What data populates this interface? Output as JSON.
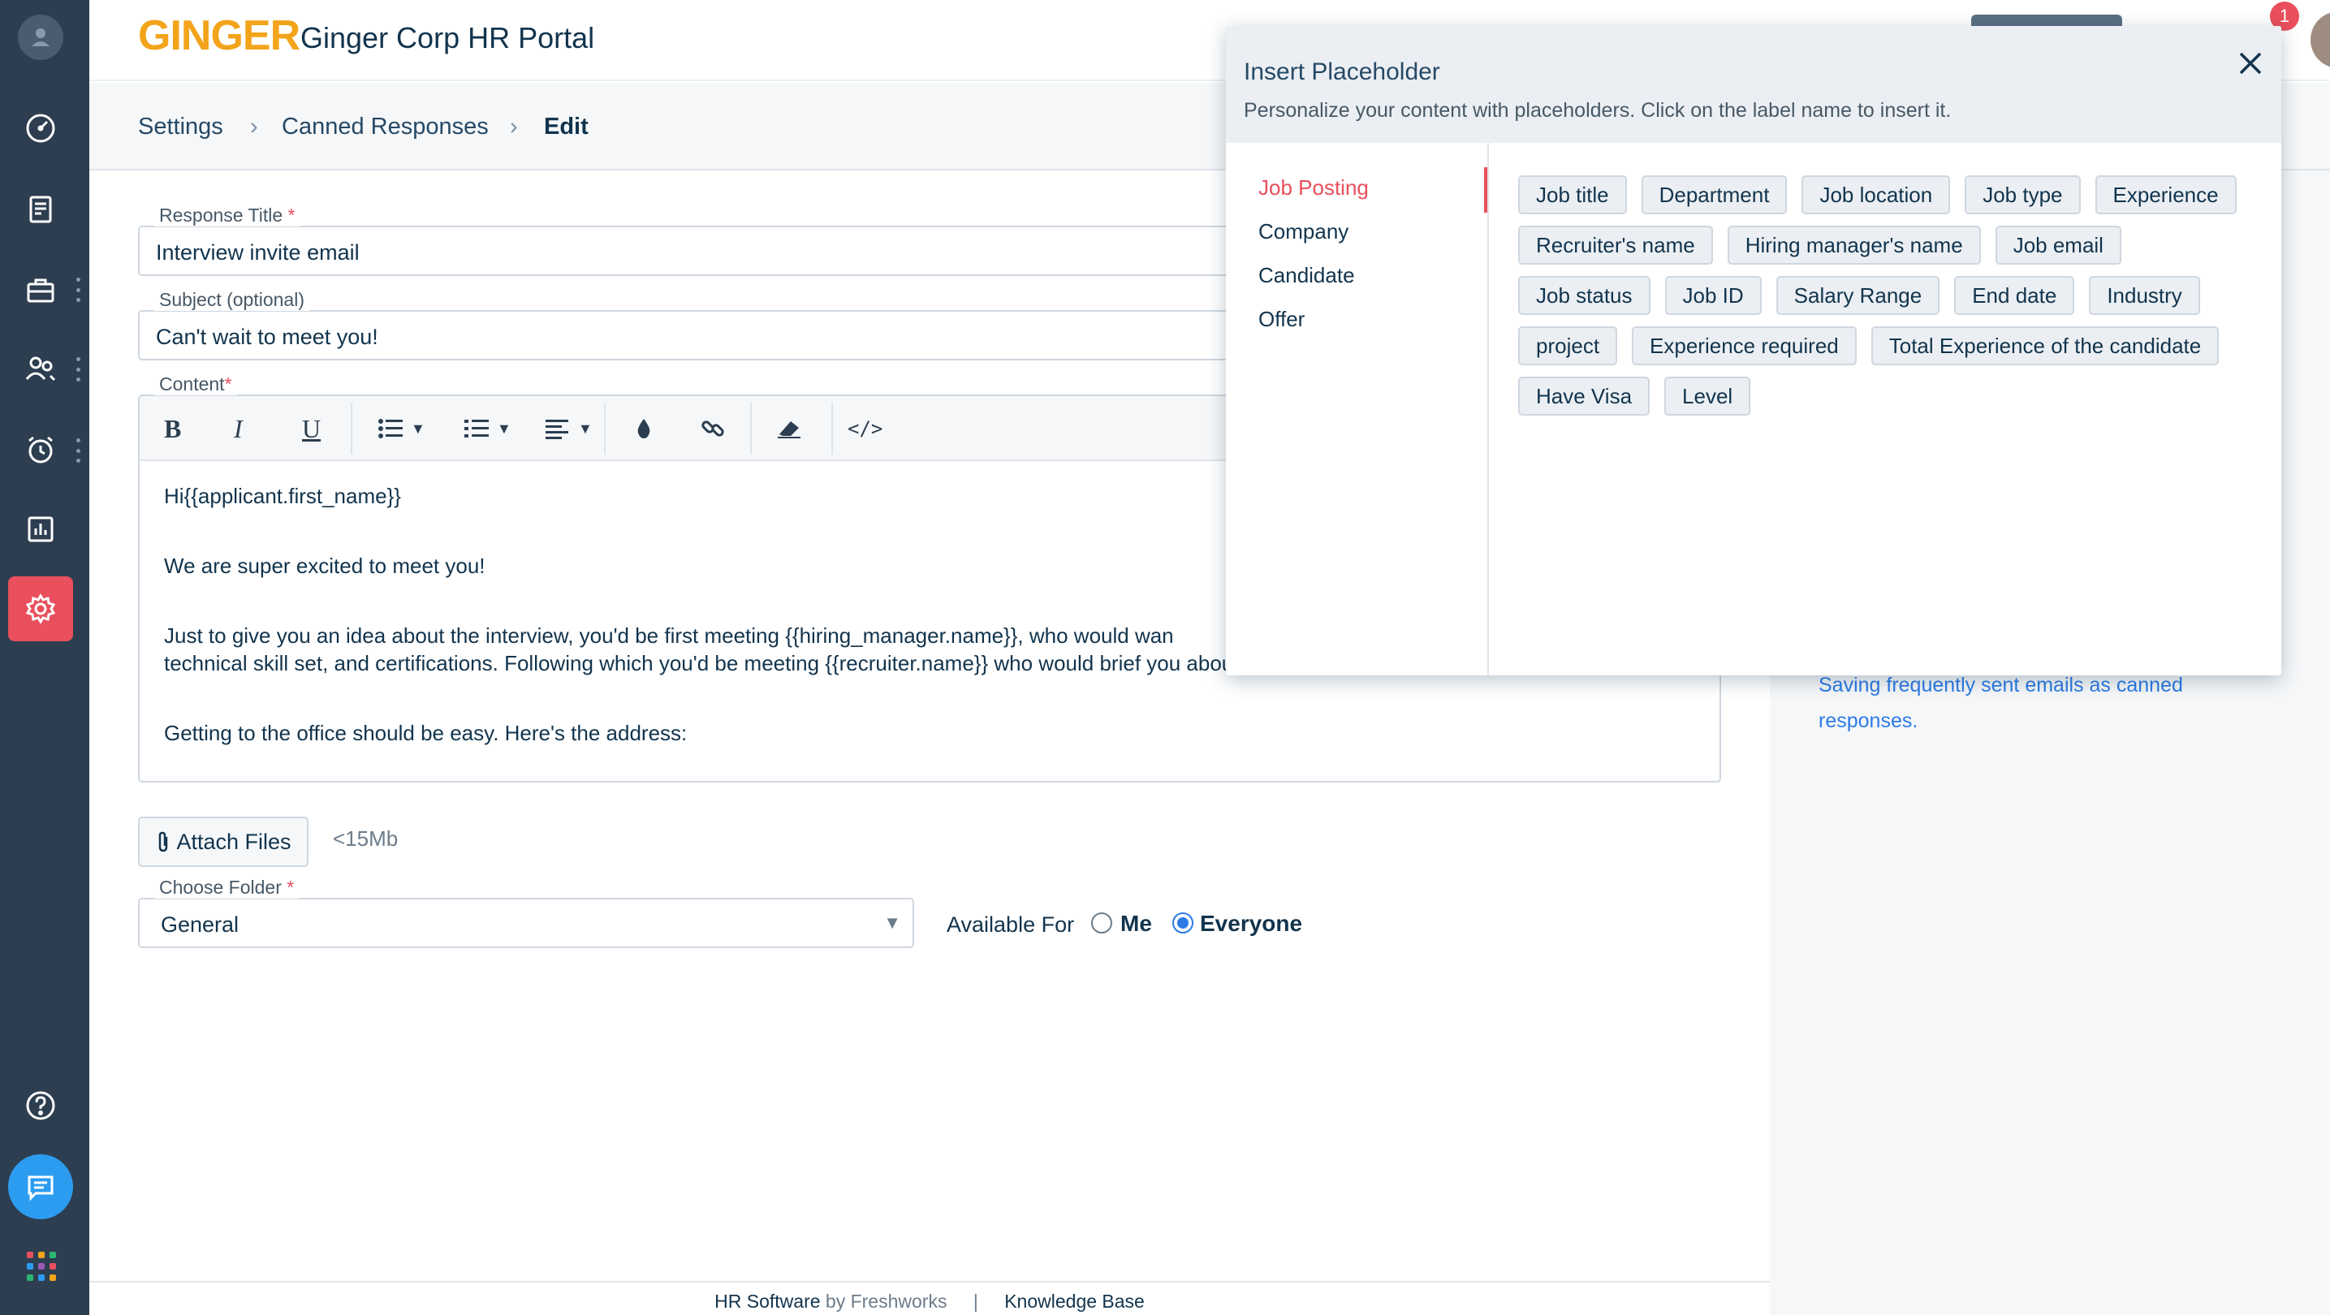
{
  "app": {
    "logo": "GINGER",
    "title": "Ginger Corp HR Portal"
  },
  "header": {
    "notification_count": "1"
  },
  "breadcrumb": [
    "Settings",
    "Canned Responses",
    "Edit"
  ],
  "form": {
    "response_title_label": "Response Title",
    "response_title_value": "Interview invite email",
    "subject_label": "Subject (optional)",
    "subject_value": "Can't wait to meet you!",
    "content_label": "Content",
    "required_mark": "*",
    "toolbar": {
      "bold": "B",
      "italic": "I",
      "underline": "U",
      "code": "</>"
    },
    "content_lines": [
      "Hi{{applicant.first_name}}",
      "We are super excited to meet you!",
      "Just to give you an idea about the interview, you'd be first meeting {{hiring_manager.name}}, who would wan",
      "technical skill set, and certifications. Following which you'd be meeting {{recruiter.name}} who would brief you about the company culture.",
      "Getting to the office should be easy. Here's the address:"
    ],
    "attach_label": "Attach Files",
    "attach_limit": "<15Mb",
    "folder_label": "Choose Folder",
    "folder_value": "General",
    "available_for_label": "Available For",
    "option_me": "Me",
    "option_everyone": "Everyone",
    "selected_option": "Everyone"
  },
  "right_panel": {
    "tip_text": "Saving frequently sent emails as canned responses."
  },
  "footer": {
    "product": "HR Software",
    "by": "by Freshworks",
    "separator": "|",
    "kb": "Knowledge Base"
  },
  "modal": {
    "title": "Insert Placeholder",
    "subtitle": "Personalize your content with placeholders. Click on the label name to insert it.",
    "categories": [
      "Job Posting",
      "Company",
      "Candidate",
      "Offer"
    ],
    "active_category": "Job Posting",
    "placeholders": [
      "Job title",
      "Department",
      "Job location",
      "Job type",
      "Experience",
      "Recruiter's name",
      "Hiring manager's name",
      "Job email",
      "Job status",
      "Job ID",
      "Salary Range",
      "End date",
      "Industry",
      "project",
      "Experience required",
      "Total Experience of the candidate",
      "Have Visa",
      "Level"
    ]
  },
  "colors": {
    "sidebar": "#2c3e50",
    "accent_active": "#e94f5c",
    "chat_button": "#2c9cf0",
    "logo": "#f3a41b",
    "link": "#2c7be5"
  }
}
